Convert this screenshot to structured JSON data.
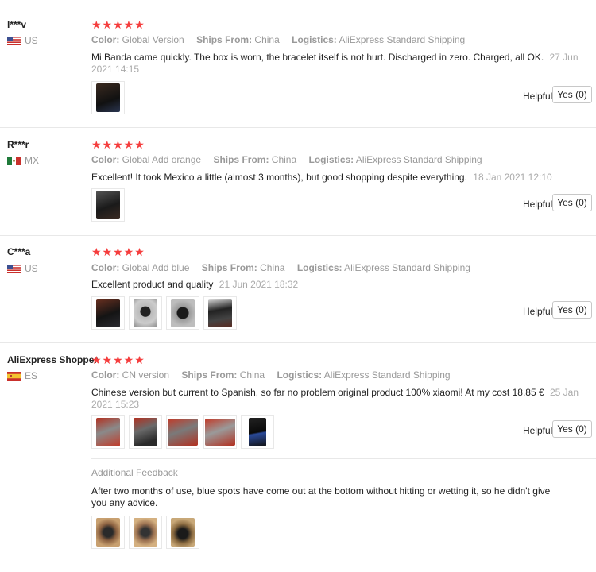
{
  "labels": {
    "color": "Color:",
    "ships_from": "Ships From:",
    "logistics": "Logistics:",
    "helpful": "Helpful?",
    "additional_feedback": "Additional Feedback"
  },
  "stars_glyph": "★★★★★",
  "reviews": [
    {
      "user": "l***v",
      "country": "US",
      "rating": 5,
      "color": "Global Version",
      "ships_from": "China",
      "logistics": "AliExpress Standard Shipping",
      "text": "Mi Banda came quickly. The box is worn, the bracelet itself is not hurt. Discharged in zero. Charged, all OK.",
      "date": "27 Jun 2021 14:15",
      "photos": 1,
      "yes_label": "Yes (0)"
    },
    {
      "user": "R***r",
      "country": "MX",
      "rating": 5,
      "color": "Global Add orange",
      "ships_from": "China",
      "logistics": "AliExpress Standard Shipping",
      "text": "Excellent! It took Mexico a little (almost 3 months), but good shopping despite everything.",
      "date": "18 Jan 2021 12:10",
      "photos": 1,
      "yes_label": "Yes (0)"
    },
    {
      "user": "C***a",
      "country": "US",
      "rating": 5,
      "color": "Global Add blue",
      "ships_from": "China",
      "logistics": "AliExpress Standard Shipping",
      "text": "Excellent product and quality",
      "date": "21 Jun 2021 18:32",
      "photos": 4,
      "yes_label": "Yes (0)"
    },
    {
      "user": "AliExpress Shopper",
      "country": "ES",
      "rating": 5,
      "color": "CN version",
      "ships_from": "China",
      "logistics": "AliExpress Standard Shipping",
      "text": "Chinese version but current to Spanish, so far no problem original product 100% xiaomi! At my cost 18,85 €",
      "date": "25 Jan 2021 15:23",
      "photos": 5,
      "yes_label": "Yes (0)",
      "additional_feedback": {
        "text": "After two months of use, blue spots have come out at the bottom without hitting or wetting it, so he didn't give you any advice.",
        "photos": 3
      }
    }
  ],
  "colors": {
    "star": "#f53d3d",
    "muted": "#999999",
    "separator": "#e8e8e8"
  }
}
